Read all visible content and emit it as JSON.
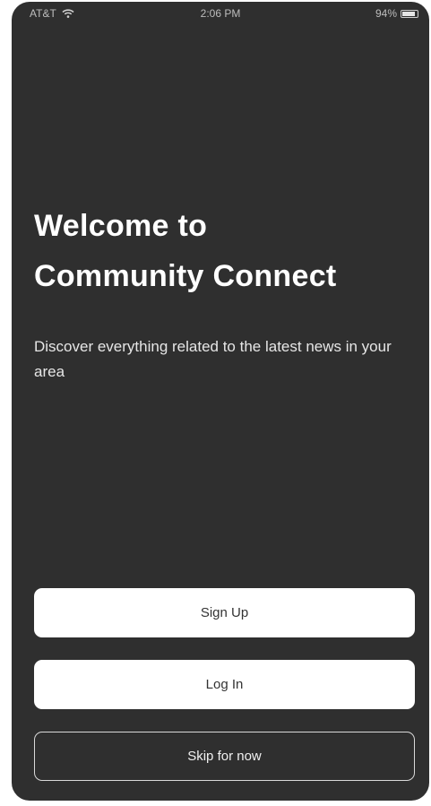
{
  "status_bar": {
    "carrier": "AT&T",
    "time": "2:06 PM",
    "battery": "94%"
  },
  "welcome": {
    "title_line1": "Welcome to",
    "title_line2": "Community Connect",
    "subtitle": "Discover everything related to the latest news in your area"
  },
  "actions": {
    "sign_up": "Sign Up",
    "log_in": "Log In",
    "skip": "Skip for now"
  }
}
